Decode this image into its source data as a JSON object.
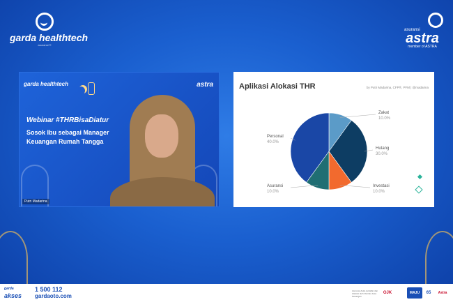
{
  "header": {
    "left_logo": {
      "brand": "garda healthtech",
      "tagline": "asuransi ©"
    },
    "right_logo": {
      "small": "asuransi",
      "brand": "astra",
      "tagline": "member of ASTRA"
    }
  },
  "video_panel": {
    "logo_left": "garda healthtech",
    "logo_right": "astra",
    "hashtag": "Webinar #THRBisaDiatur",
    "title": "Sosok Ibu sebagai Manager Keuangan Rumah Tangga",
    "speaker_name": "Putri Madarina"
  },
  "chart_panel": {
    "title": "Aplikasi Alokasi THR",
    "byline": "by Putri Madarina, CFP®, PFM | @madarina",
    "colors": {
      "Zakat": "#5b9bc8",
      "Hutang": "#0d3d63",
      "Investasi": "#f26a2e",
      "Asuransi": "#1f6e73",
      "Personal": "#1a47a6"
    }
  },
  "chart_data": {
    "type": "pie",
    "title": "Aplikasi Alokasi THR",
    "slices": [
      {
        "label": "Zakat",
        "value": 10,
        "pct_text": "10.0%"
      },
      {
        "label": "Hutang",
        "value": 30,
        "pct_text": "30.0%"
      },
      {
        "label": "Investasi",
        "value": 10,
        "pct_text": "10.0%"
      },
      {
        "label": "Asuransi",
        "value": 10,
        "pct_text": "10.0%"
      },
      {
        "label": "Personal",
        "value": 40,
        "pct_text": "40.0%"
      }
    ]
  },
  "footer": {
    "logo_top": "garda",
    "logo_bottom": "akses",
    "phone": "1 500 112",
    "website": "gardaoto.com",
    "ojk_text": "Asuransi Astra terdaftar dan diawasi oleh Otoritas Jasa Keuangan",
    "badges": [
      "OJK",
      "MAJU",
      "65",
      "Astra"
    ]
  }
}
